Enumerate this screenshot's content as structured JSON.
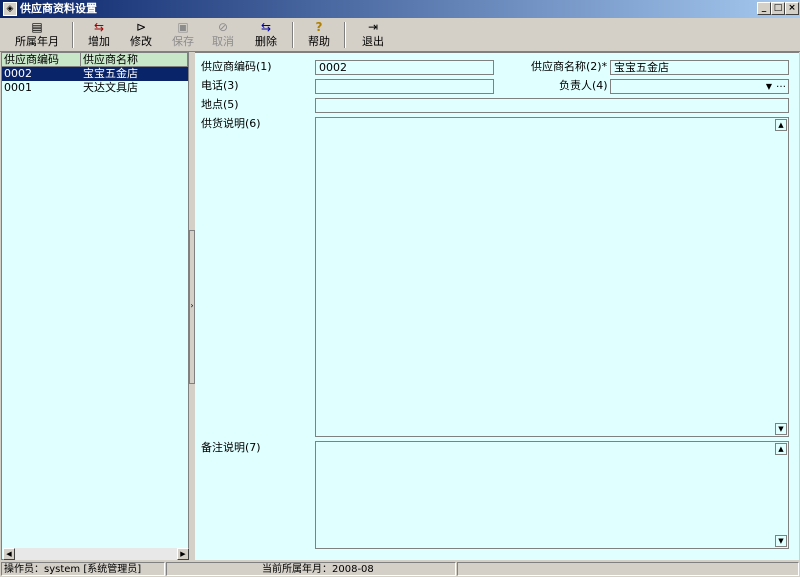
{
  "window": {
    "title": "供应商资料设置",
    "icon": "app-icon",
    "controls": {
      "minimize": "_",
      "maximize": "□",
      "close": "×"
    }
  },
  "toolbar": {
    "items": [
      {
        "label": "所属年月",
        "icon": "calendar-icon",
        "glyph": "▤",
        "enabled": true
      },
      {
        "label": "增加",
        "icon": "add-icon",
        "glyph": "⇆",
        "enabled": true
      },
      {
        "label": "修改",
        "icon": "edit-icon",
        "glyph": "⊳",
        "enabled": true
      },
      {
        "label": "保存",
        "icon": "save-icon",
        "glyph": "▣",
        "enabled": false
      },
      {
        "label": "取消",
        "icon": "cancel-icon",
        "glyph": "⊘",
        "enabled": false
      },
      {
        "label": "删除",
        "icon": "delete-icon",
        "glyph": "⇆",
        "enabled": true
      },
      {
        "label": "帮助",
        "icon": "help-icon",
        "glyph": "?",
        "enabled": true
      },
      {
        "label": "退出",
        "icon": "exit-icon",
        "glyph": "⇥",
        "enabled": true
      }
    ]
  },
  "supplier_list": {
    "columns": [
      "供应商编码",
      "供应商名称"
    ],
    "rows": [
      {
        "code": "0002",
        "name": "宝宝五金店",
        "selected": true
      },
      {
        "code": "0001",
        "name": "天达文具店",
        "selected": false
      }
    ]
  },
  "form": {
    "code_label": "供应商编码(1)",
    "code_value": "0002",
    "name_label": "供应商名称(2)*",
    "name_value": "宝宝五金店",
    "phone_label": "电话(3)",
    "phone_value": "",
    "contact_label": "负责人(4)",
    "contact_value": "",
    "contact_dropdown_glyph": "▼",
    "contact_more_glyph": "…",
    "address_label": "地点(5)",
    "address_value": "",
    "supply_desc_label": "供货说明(6)",
    "supply_desc_value": "",
    "remark_label": "备注说明(7)",
    "remark_value": ""
  },
  "statusbar": {
    "operator": "操作员：system [系统管理员]",
    "period": "当前所属年月：2008-08"
  },
  "colors": {
    "pane_background": "#e0ffff",
    "selected_row": "#0a246a",
    "grid_header": "#c8e6c8"
  }
}
